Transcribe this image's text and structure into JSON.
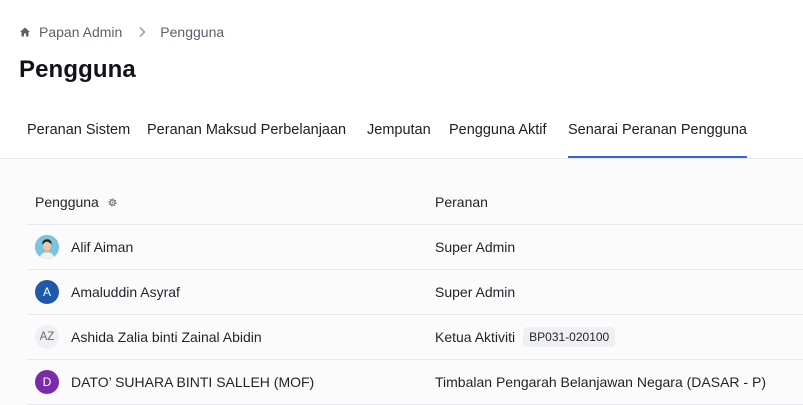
{
  "breadcrumb": {
    "home_label": "Papan Admin",
    "current_label": "Pengguna"
  },
  "page": {
    "title": "Pengguna"
  },
  "tabs": [
    {
      "label": "Peranan Sistem",
      "active": false
    },
    {
      "label": "Peranan Maksud Perbelanjaan",
      "active": false
    },
    {
      "label": "Jemputan",
      "active": false
    },
    {
      "label": "Pengguna Aktif",
      "active": false
    },
    {
      "label": "Senarai Peranan Pengguna",
      "active": true
    }
  ],
  "table": {
    "headers": {
      "user": "Pengguna",
      "role": "Peranan"
    },
    "rows": [
      {
        "avatar": "photo",
        "initials": "",
        "name": "Alif Aiman",
        "role": "Super Admin",
        "badge": ""
      },
      {
        "avatar": "blue",
        "initials": "A",
        "name": "Amaluddin Asyraf",
        "role": "Super Admin",
        "badge": ""
      },
      {
        "avatar": "grey",
        "initials": "AZ",
        "name": "Ashida Zalia binti Zainal Abidin",
        "role": "Ketua Aktiviti",
        "badge": "BP031-020100"
      },
      {
        "avatar": "purple",
        "initials": "D",
        "name": "DATO’ SUHARA BINTI SALLEH (MOF)",
        "role": "Timbalan Pengarah Belanjawan Negara (DASAR - P)",
        "badge": ""
      }
    ]
  },
  "colors": {
    "accent": "#3563e9",
    "avatar_blue": "#1e5aa8",
    "avatar_purple": "#7b2ba9"
  },
  "icons": {
    "home": "home-icon",
    "separator": "chevron-right-icon",
    "column_settings": "gear-icon"
  }
}
